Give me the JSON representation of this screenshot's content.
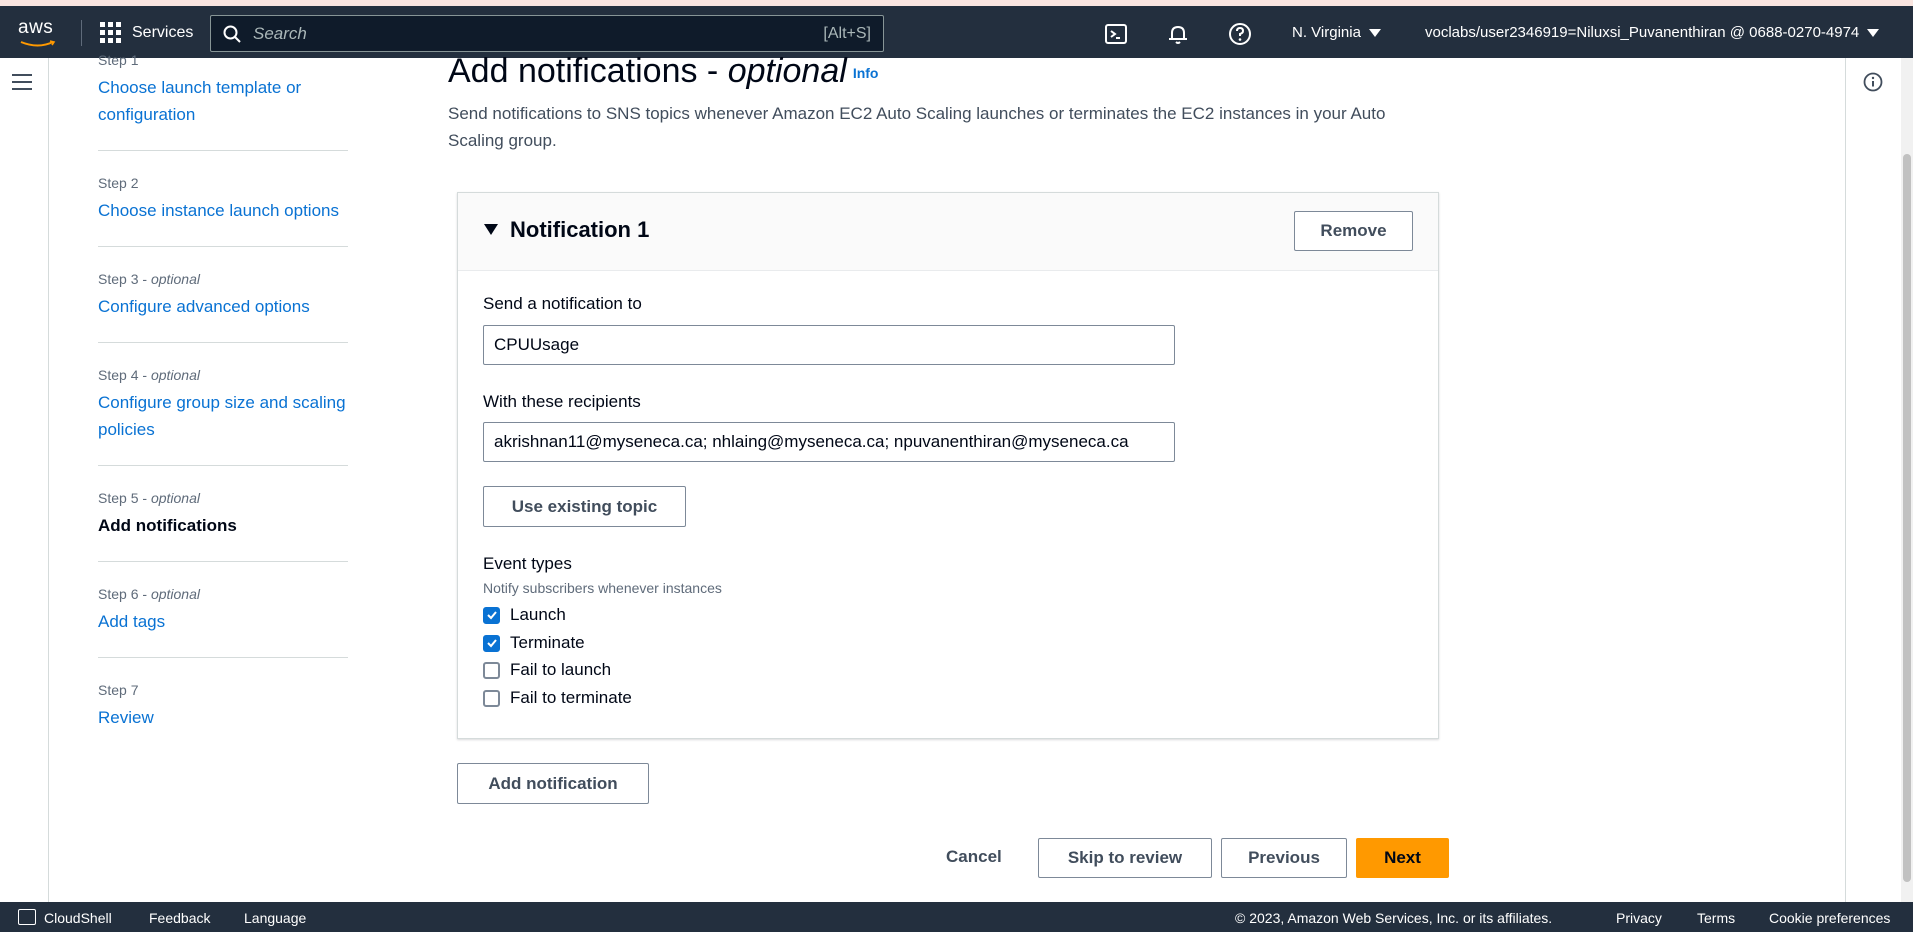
{
  "nav": {
    "logo": "aws",
    "services": "Services",
    "search_placeholder": "Search",
    "search_shortcut": "[Alt+S]",
    "region": "N. Virginia",
    "account": "voclabs/user2346919=Niluxsi_Puvanenthiran @ 0688-0270-4974"
  },
  "steps": [
    {
      "number": "Step 1",
      "optional": "",
      "label": "Choose launch template or configuration",
      "current": false
    },
    {
      "number": "Step 2",
      "optional": "",
      "label": "Choose instance launch options",
      "current": false
    },
    {
      "number": "Step 3",
      "optional": "optional",
      "label": "Configure advanced options",
      "current": false
    },
    {
      "number": "Step 4",
      "optional": "optional",
      "label": "Configure group size and scaling policies",
      "current": false
    },
    {
      "number": "Step 5",
      "optional": "optional",
      "label": "Add notifications",
      "current": true
    },
    {
      "number": "Step 6",
      "optional": "optional",
      "label": "Add tags",
      "current": false
    },
    {
      "number": "Step 7",
      "optional": "",
      "label": "Review",
      "current": false
    }
  ],
  "header": {
    "title": "Add notifications - ",
    "title_optional": "optional",
    "info": "Info",
    "description": "Send notifications to SNS topics whenever Amazon EC2 Auto Scaling launches or terminates the EC2 instances in your Auto Scaling group."
  },
  "notification": {
    "title": "Notification 1",
    "remove": "Remove",
    "send_to_label": "Send a notification to",
    "send_to_value": "CPUUsage",
    "recipients_label": "With these recipients",
    "recipients_value": "akrishnan11@myseneca.ca; nhlaing@myseneca.ca; npuvanenthiran@myseneca.ca",
    "use_existing_topic": "Use existing topic",
    "event_types_label": "Event types",
    "event_types_desc": "Notify subscribers whenever instances",
    "events": [
      {
        "label": "Launch",
        "checked": true
      },
      {
        "label": "Terminate",
        "checked": true
      },
      {
        "label": "Fail to launch",
        "checked": false
      },
      {
        "label": "Fail to terminate",
        "checked": false
      }
    ]
  },
  "actions": {
    "add_notification": "Add notification",
    "cancel": "Cancel",
    "skip": "Skip to review",
    "previous": "Previous",
    "next": "Next"
  },
  "footer": {
    "cloudshell": "CloudShell",
    "feedback": "Feedback",
    "language": "Language",
    "copyright": "© 2023, Amazon Web Services, Inc. or its affiliates.",
    "privacy": "Privacy",
    "terms": "Terms",
    "cookies": "Cookie preferences"
  },
  "colors": {
    "nav_bg": "#232f3e",
    "link": "#0972d3",
    "primary_button": "#ff9900"
  }
}
